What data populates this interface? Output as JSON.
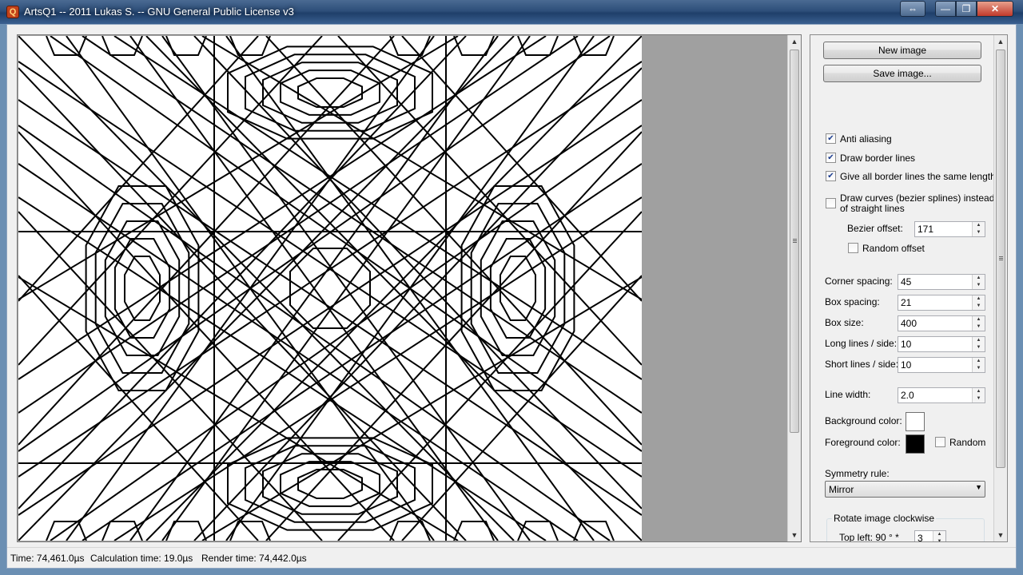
{
  "window": {
    "title": "ArtsQ1 -- 2011 Lukas S. -- GNU General Public License v3",
    "app_icon_glyph": "Q",
    "controls": {
      "extra": "⇔",
      "minimize": "—",
      "maximize": "❐",
      "close": "✕"
    }
  },
  "actions": {
    "new_image": "New image",
    "save_image": "Save image..."
  },
  "options": {
    "anti_aliasing": {
      "label": "Anti aliasing",
      "checked": true
    },
    "draw_border_lines": {
      "label": "Draw border lines",
      "checked": true
    },
    "same_length": {
      "label": "Give all border lines the same length",
      "checked": true
    },
    "draw_curves": {
      "label_line1": "Draw curves (bezier splines) instead",
      "label_line2": "of straight lines",
      "checked": false
    },
    "bezier_offset": {
      "label": "Bezier offset:",
      "value": "171"
    },
    "random_offset": {
      "label": "Random offset",
      "checked": false
    }
  },
  "params": {
    "corner_spacing": {
      "label": "Corner spacing:",
      "value": "45"
    },
    "box_spacing": {
      "label": "Box spacing:",
      "value": "21"
    },
    "box_size": {
      "label": "Box size:",
      "value": "400"
    },
    "long_lines": {
      "label": "Long lines / side:",
      "value": "10"
    },
    "short_lines": {
      "label": "Short lines / side:",
      "value": "10"
    },
    "line_width": {
      "label": "Line width:",
      "value": "2.0"
    }
  },
  "colors": {
    "background_label": "Background color:",
    "background_value": "#ffffff",
    "foreground_label": "Foreground color:",
    "foreground_value": "#000000",
    "random_label": "Random",
    "random_checked": false
  },
  "symmetry": {
    "label": "Symmetry rule:",
    "value": "Mirror"
  },
  "rotate": {
    "group_label": "Rotate image clockwise",
    "top_left_label": "Top left:  90 ° *",
    "top_left_value": "3"
  },
  "status": {
    "time": "Time: 74,461.0µs",
    "calc": "Calculation time: 19.0µs",
    "render": "Render time: 74,442.0µs"
  }
}
